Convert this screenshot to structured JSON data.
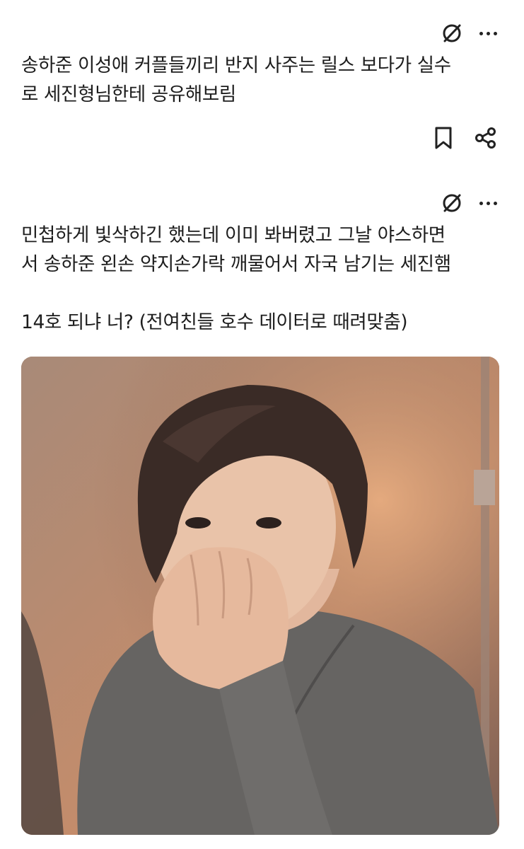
{
  "post1": {
    "text": "송하준 이성애 커플들끼리 반지 사주는 릴스 보다가  실수\n로 세진형님한테 공유해보림",
    "icons": {
      "translate": "no-translate-icon",
      "more": "more-dots-icon",
      "bookmark": "bookmark-icon",
      "share": "share-icon"
    }
  },
  "post2": {
    "text": "민첩하게 빛삭하긴 했는데 이미 봐버렸고  그날 야스하면\n서 송하준 왼손 약지손가락 깨물어서 자국 남기는 세진햄\n\n14호 되냐 너?  (전여친들 호수 데이터로 때려맞춤)",
    "icons": {
      "translate": "no-translate-icon",
      "more": "more-dots-icon"
    },
    "image": {
      "subject": "photo"
    }
  },
  "colors": {
    "text": "#1d1d1d",
    "icon": "#222222",
    "background": "#ffffff"
  }
}
